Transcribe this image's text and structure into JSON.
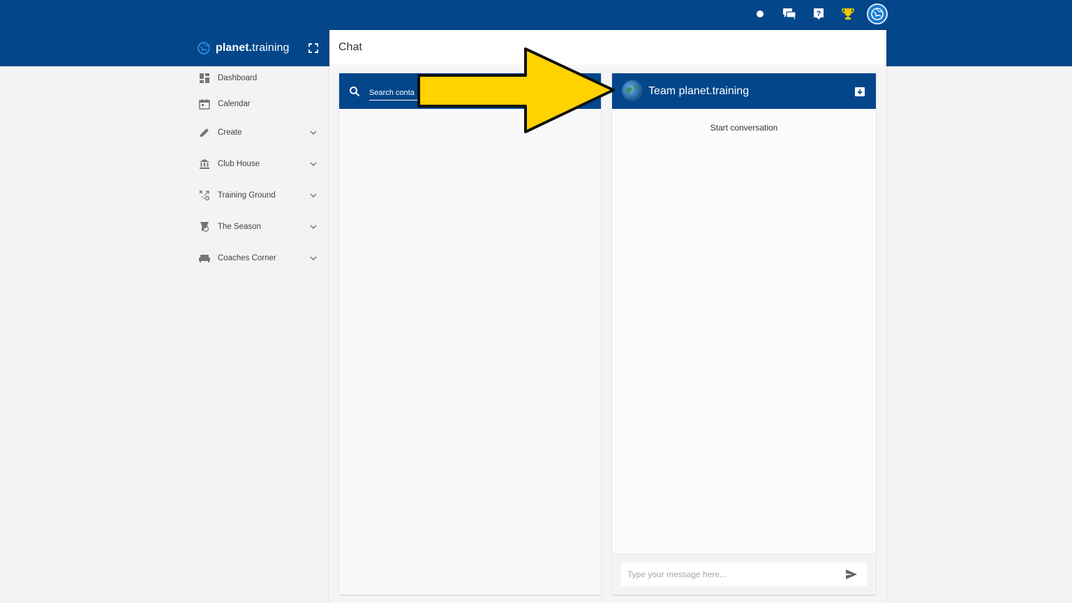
{
  "brand": {
    "bold": "planet.",
    "rest": "training"
  },
  "page": {
    "title": "Chat"
  },
  "sidebar": {
    "items": [
      {
        "label": "Dashboard"
      },
      {
        "label": "Calendar"
      },
      {
        "label": "Create"
      },
      {
        "label": "Club House"
      },
      {
        "label": "Training Ground"
      },
      {
        "label": "The Season"
      },
      {
        "label": "Coaches Corner"
      }
    ]
  },
  "contacts": {
    "search_placeholder": "Search conta"
  },
  "conversation": {
    "name": "Team planet.training",
    "start_label": "Start conversation",
    "message_placeholder": "Type your message here..."
  },
  "colors": {
    "header_blue": "#03468a",
    "trophy_yellow": "#f2c500",
    "annotation_arrow": "#ffd200"
  },
  "icons": {
    "topbar": [
      "status-dot-icon",
      "chat-icon",
      "help-icon",
      "trophy-icon",
      "avatar-logo-icon"
    ],
    "sidebar": [
      "dashboard-icon",
      "calendar-icon",
      "pencil-icon",
      "bank-icon",
      "tactics-icon",
      "trophy-icon",
      "sofa-icon"
    ]
  }
}
